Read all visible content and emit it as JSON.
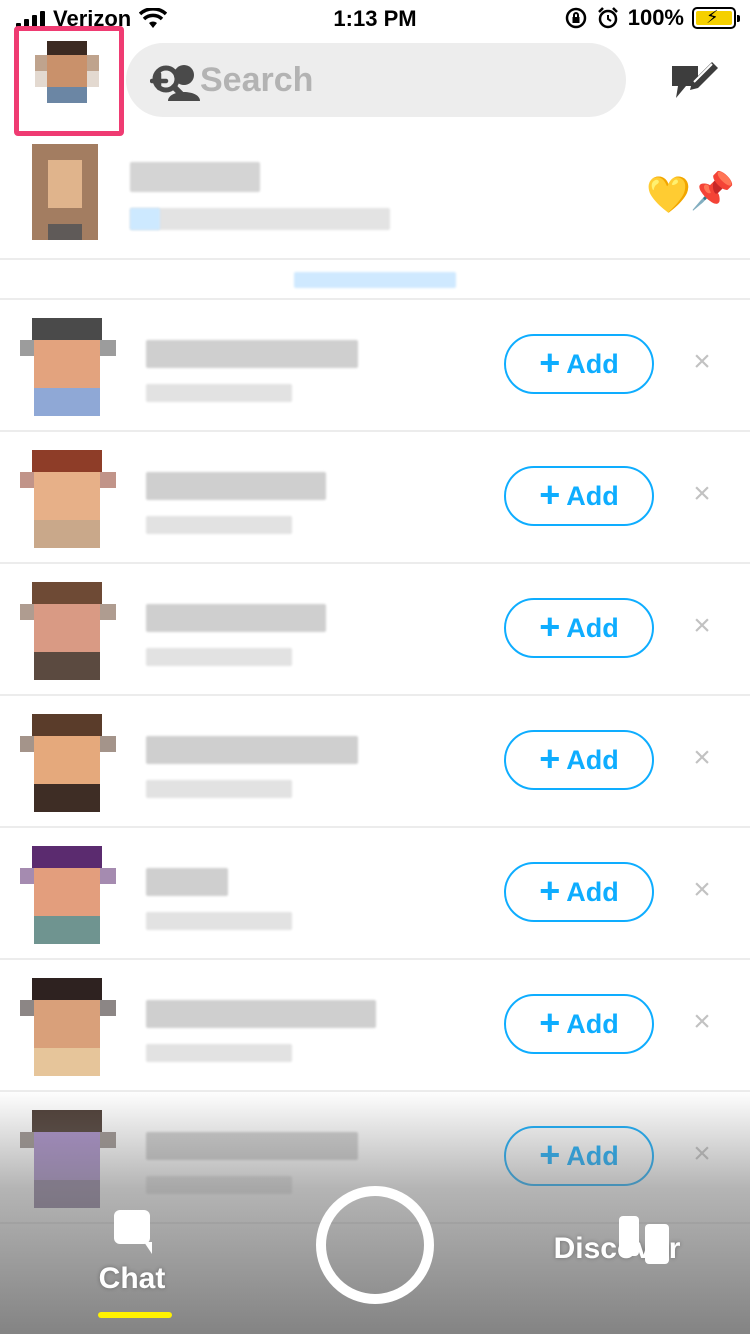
{
  "status_bar": {
    "carrier": "Verizon",
    "time": "1:13 PM",
    "battery_percent": "100%"
  },
  "header": {
    "search_placeholder": "Search"
  },
  "pinned_chat": {
    "emojis": [
      "💛",
      "📌"
    ]
  },
  "quick_add": {
    "add_label": "Add",
    "dismiss_label": "×",
    "items": [
      {
        "id": 1
      },
      {
        "id": 2
      },
      {
        "id": 3
      },
      {
        "id": 4
      },
      {
        "id": 5
      },
      {
        "id": 6
      },
      {
        "id": 7
      }
    ]
  },
  "bottom_nav": {
    "chat_label": "Chat",
    "discover_label": "Discover"
  },
  "colors": {
    "accent_blue": "#0eadff",
    "highlight_pink": "#ef3b72",
    "active_tab_yellow": "#fff200"
  }
}
